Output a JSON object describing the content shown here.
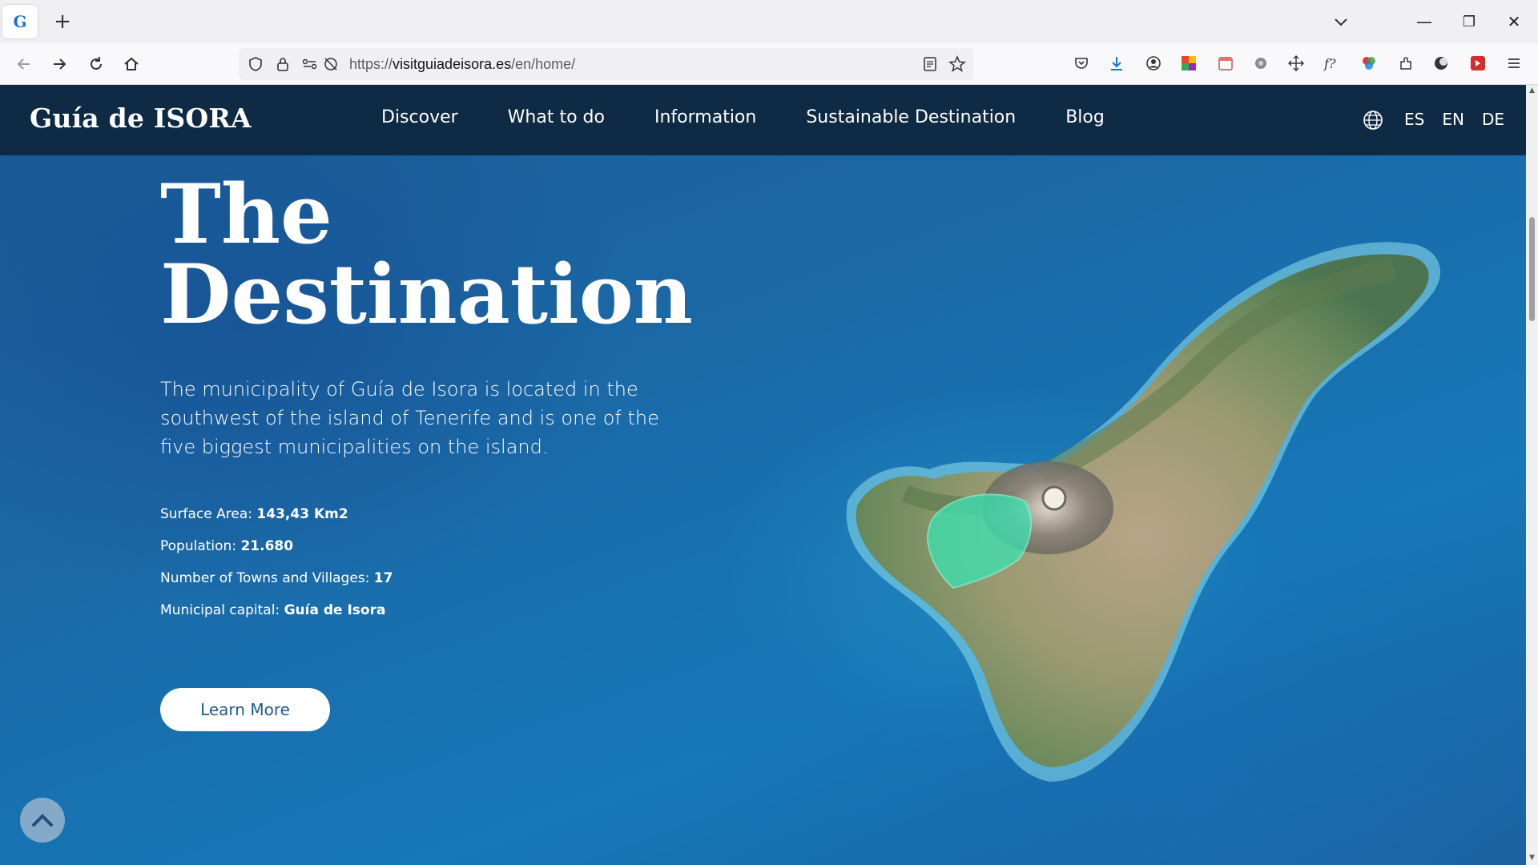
{
  "browser": {
    "tab_favicon": "G",
    "new_tab_symbol": "+",
    "url_prefix": "https://",
    "url_host": "visitguiadeisora.es",
    "url_path": "/en/home/",
    "window_controls": {
      "minimize": "—",
      "maximize": "❐",
      "close": "✕"
    }
  },
  "site": {
    "logo": "Guía de ISORA",
    "nav": [
      "Discover",
      "What to do",
      "Information",
      "Sustainable Destination",
      "Blog"
    ],
    "languages": [
      "ES",
      "EN",
      "DE"
    ]
  },
  "hero": {
    "title_line1": "The",
    "title_line2": "Destination",
    "description": "The municipality of Guía de Isora is located in the southwest of the island of Tenerife and is one of the five biggest municipalities on the island.",
    "facts": [
      {
        "label": "Surface Area: ",
        "value": "143,43 Km2"
      },
      {
        "label": "Population: ",
        "value": "21.680"
      },
      {
        "label": "Number of Towns and Villages: ",
        "value": "17"
      },
      {
        "label": "Municipal capital: ",
        "value": "Guía de Isora"
      }
    ],
    "cta_label": "Learn More"
  },
  "colors": {
    "header_bg": "#0f2a44",
    "ocean": "#1b6aa8",
    "highlight_region": "#3de0b0",
    "button_text": "#1f5a8a"
  }
}
